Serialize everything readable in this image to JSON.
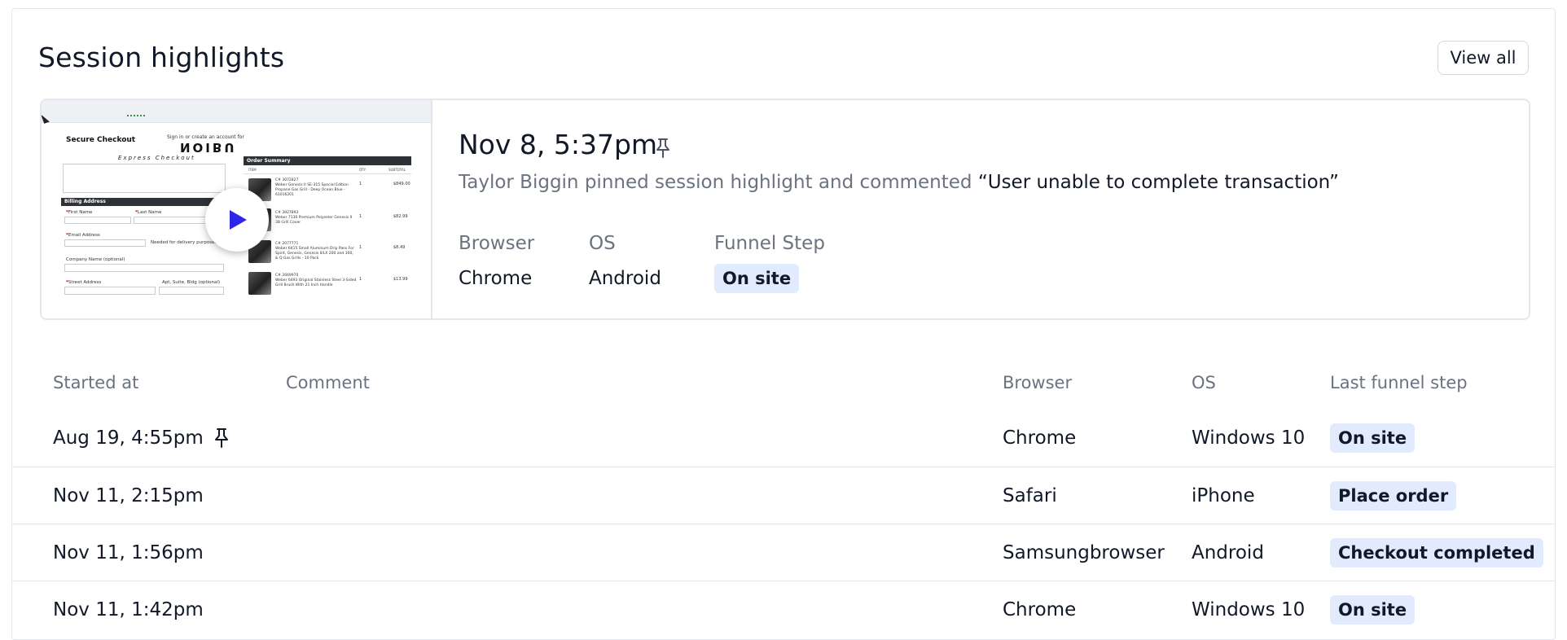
{
  "header": {
    "title": "Session highlights",
    "view_all_label": "View all"
  },
  "highlight": {
    "date": "Nov 8, 5:37pm",
    "pinned": true,
    "description": "Taylor Biggin pinned session highlight and commented",
    "comment": "“User unable to complete transaction”",
    "meta": {
      "browser_label": "Browser",
      "browser_value": "Chrome",
      "os_label": "OS",
      "os_value": "Android",
      "funnel_label": "Funnel Step",
      "funnel_value": "On site"
    },
    "thumbnail": {
      "page_title": "Secure Checkout",
      "sign_in_text": "Sign in or create an account for",
      "logo_text": "NOIBU",
      "express_text": "Express Checkout",
      "billing_section": "Billing Address",
      "first_name": "First Name",
      "last_name": "Last Name",
      "email": "Email Address",
      "delivery_note": "Needed for delivery purposes",
      "company": "Company Name (optional)",
      "street": "Street Address",
      "apt": "Apt, Suite, Bldg (optional)",
      "order_summary": "Order Summary",
      "columns": [
        "ITEM",
        "QTY",
        "SUBTOTAL"
      ],
      "items": [
        {
          "sku": "C# 3072827",
          "text": "Weber Genesis II SE-315 Special Edition Propane Gas Grill - Deep Ocean Blue - 61016201",
          "qty": "1",
          "price": "$849.00"
        },
        {
          "sku": "C# 3927893",
          "text": "Weber 7130 Premium Polyester Genesis II 3B Grill Cover",
          "qty": "1",
          "price": "$82.99"
        },
        {
          "sku": "C# 2077771",
          "text": "Weber 6415 Small Aluminum Drip Pans For Spirit, Genesis, Genesis II/LX 200 and 300, & Q Gas Grills - 10 Pack",
          "qty": "1",
          "price": "$8.49"
        },
        {
          "sku": "C# 2669970",
          "text": "Weber 6493 Original Stainless Steel 3-Sided Grill Brush With 21 Inch Handle",
          "qty": "1",
          "price": "$13.99"
        }
      ]
    }
  },
  "table": {
    "columns": {
      "started_at": "Started at",
      "comment": "Comment",
      "browser": "Browser",
      "os": "OS",
      "last_funnel_step": "Last funnel step"
    },
    "rows": [
      {
        "started_at": "Aug 19, 4:55pm",
        "pinned": true,
        "comment": "",
        "browser": "Chrome",
        "os": "Windows 10",
        "funnel": "On site"
      },
      {
        "started_at": "Nov 11, 2:15pm",
        "pinned": false,
        "comment": "",
        "browser": "Safari",
        "os": "iPhone",
        "funnel": "Place order"
      },
      {
        "started_at": "Nov 11, 1:56pm",
        "pinned": false,
        "comment": "",
        "browser": "Samsungbrowser",
        "os": "Android",
        "funnel": "Checkout completed"
      },
      {
        "started_at": "Nov 11, 1:42pm",
        "pinned": false,
        "comment": "",
        "browser": "Chrome",
        "os": "Windows 10",
        "funnel": "On site"
      }
    ]
  },
  "colors": {
    "badge_bg": "#e2ebfd",
    "play_icon": "#2f24e8",
    "muted_text": "#6b7280"
  }
}
